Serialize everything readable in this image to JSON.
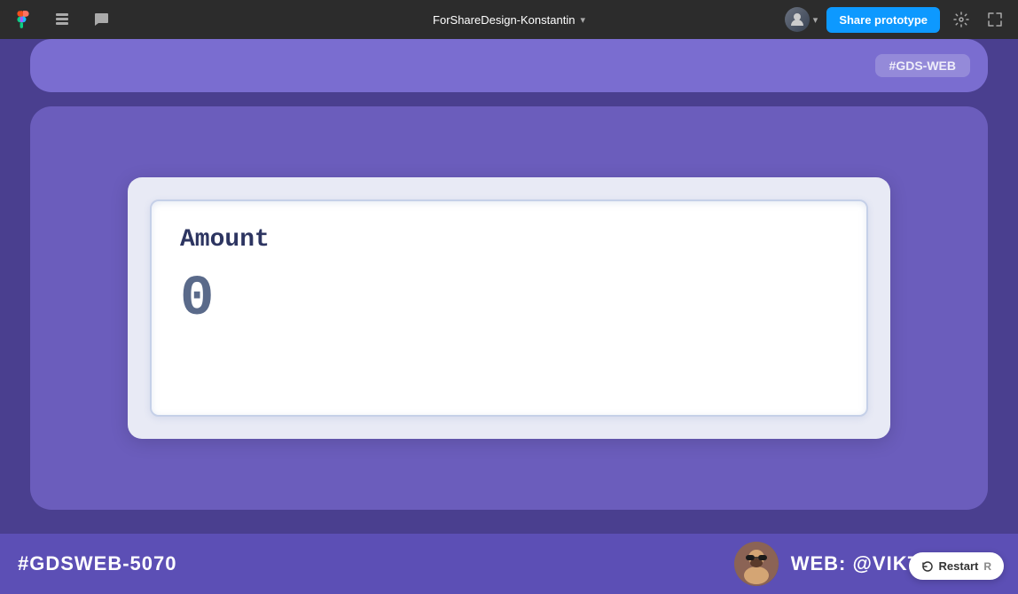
{
  "toolbar": {
    "title": "ForShareDesign-Konstantin",
    "share_button": "Share prototype",
    "chevron": "▾"
  },
  "canvas": {
    "top_card_text": "#GDS-WEB",
    "amount_label": "Amount",
    "amount_value": "0",
    "hashtag": "#GDSWEB-5070",
    "web_handle": "WEB: @VIKTOR.SEC"
  },
  "restart": {
    "label": "Restart",
    "key": "R"
  }
}
